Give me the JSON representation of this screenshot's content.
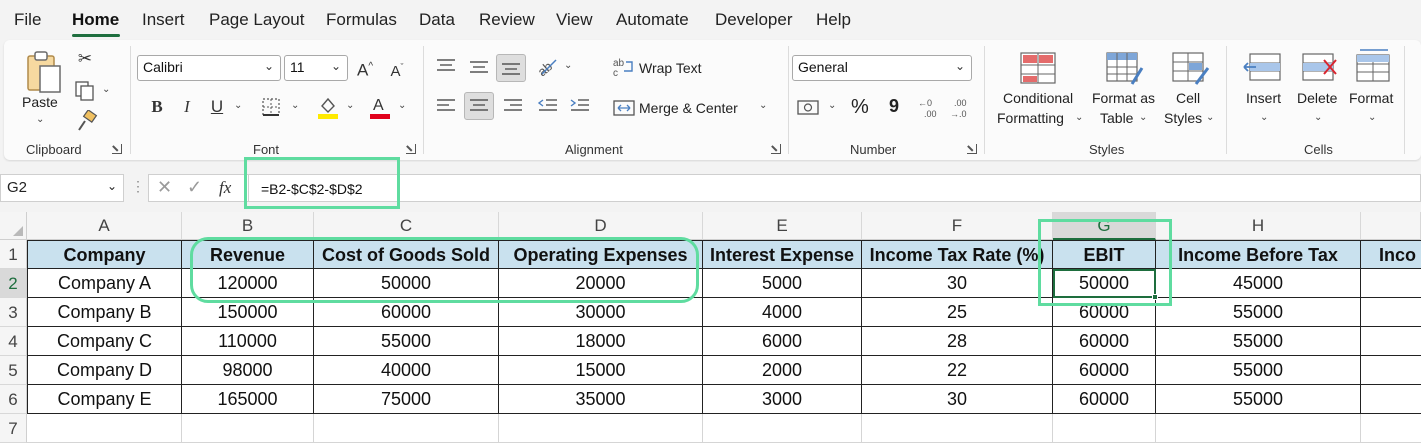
{
  "menu": {
    "items": [
      "File",
      "Home",
      "Insert",
      "Page Layout",
      "Formulas",
      "Data",
      "Review",
      "View",
      "Automate",
      "Developer",
      "Help"
    ],
    "active": "Home"
  },
  "ribbon": {
    "clipboard": {
      "paste": "Paste",
      "label": "Clipboard"
    },
    "font": {
      "family": "Calibri",
      "size": "11",
      "label": "Font",
      "bold": "B",
      "italic": "I",
      "underline": "U"
    },
    "alignment": {
      "wrap_text": "Wrap Text",
      "merge_center": "Merge & Center",
      "label": "Alignment"
    },
    "number": {
      "format": "General",
      "percent": "%",
      "comma": "9",
      "label": "Number"
    },
    "styles": {
      "conditional_1": "Conditional",
      "conditional_2": "Formatting",
      "format_table_1": "Format as",
      "format_table_2": "Table",
      "cell_styles_1": "Cell",
      "cell_styles_2": "Styles",
      "label": "Styles"
    },
    "cells": {
      "insert": "Insert",
      "delete": "Delete",
      "format": "Format",
      "label": "Cells"
    }
  },
  "formula_bar": {
    "name_box": "G2",
    "fx": "fx",
    "formula": "=B2-$C$2-$D$2"
  },
  "columns": [
    "A",
    "B",
    "C",
    "D",
    "E",
    "F",
    "G",
    "H",
    ""
  ],
  "rows": [
    "1",
    "2",
    "3",
    "4",
    "5",
    "6",
    "7"
  ],
  "table": {
    "headers": [
      "Company",
      "Revenue",
      "Cost of Goods Sold",
      "Operating Expenses",
      "Interest Expense",
      "Income Tax Rate (%)",
      "EBIT",
      "Income Before Tax",
      "Inco"
    ],
    "data": [
      [
        "Company A",
        "120000",
        "50000",
        "20000",
        "5000",
        "30",
        "50000",
        "45000",
        ""
      ],
      [
        "Company B",
        "150000",
        "60000",
        "30000",
        "4000",
        "25",
        "60000",
        "55000",
        ""
      ],
      [
        "Company C",
        "110000",
        "55000",
        "18000",
        "6000",
        "28",
        "60000",
        "55000",
        ""
      ],
      [
        "Company D",
        "98000",
        "40000",
        "15000",
        "2000",
        "22",
        "60000",
        "55000",
        ""
      ],
      [
        "Company E",
        "165000",
        "75000",
        "35000",
        "3000",
        "30",
        "60000",
        "55000",
        ""
      ]
    ]
  },
  "colors": {
    "accent": "#1e6e3e",
    "header_fill": "#c9e1ee",
    "highlight": "#5fdca0"
  }
}
